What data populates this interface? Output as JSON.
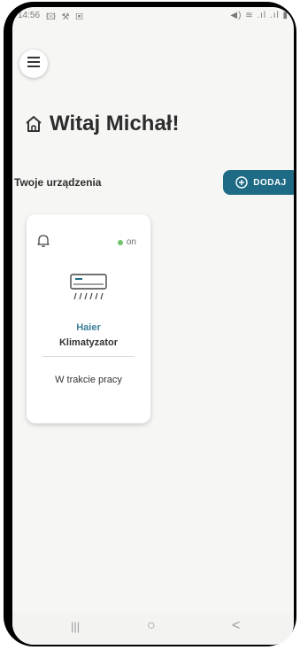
{
  "status_bar": {
    "time": "14:56",
    "left_icons": "🖾 ⚒ ▣",
    "right_icons": "◀) ≋ .ıl .ıl ▮"
  },
  "header": {
    "greeting": "Witaj Michał!"
  },
  "devices_section": {
    "title": "Twoje urządzenia",
    "add_button_label": "DODAJ"
  },
  "device_card": {
    "status": "on",
    "status_color": "#6cc36a",
    "brand": "Haier",
    "device_type": "Klimatyzator",
    "state": "W trakcie pracy",
    "icon": "air-conditioner-icon"
  },
  "colors": {
    "accent": "#1f6b86",
    "brand_text": "#3c7f98",
    "background": "#f6f6f5"
  },
  "nav_bar": {
    "recents": "|||",
    "home": "○",
    "back": "<"
  }
}
